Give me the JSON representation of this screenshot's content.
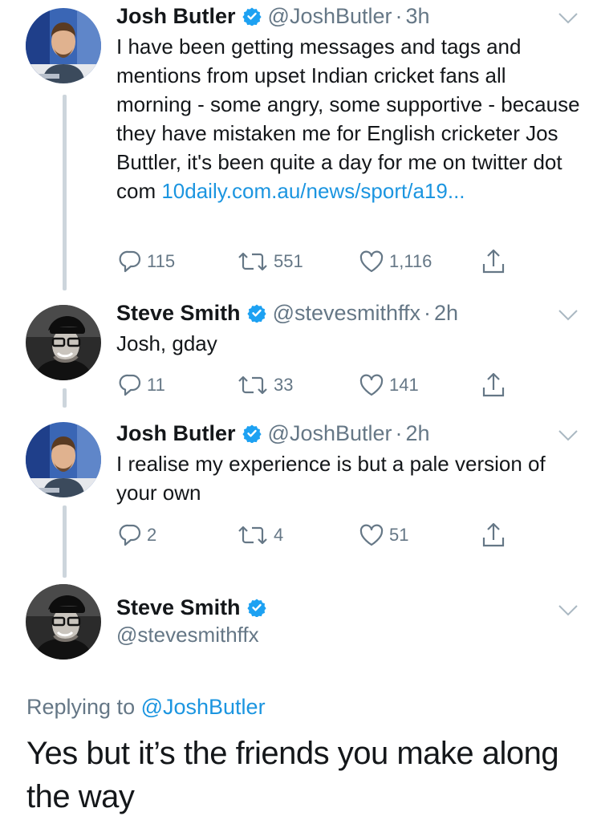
{
  "tweets": [
    {
      "name": "Josh Butler",
      "handle": "@JoshButler",
      "time": "3h",
      "text": "I have been getting messages and tags and mentions from upset Indian cricket fans all morning - some angry, some supportive - because they have mistaken me for English cricketer Jos Buttler, it's been quite a day for me on twitter dot com ",
      "link": "10daily.com.au/news/sport/a19...",
      "replies": "115",
      "retweets": "551",
      "likes": "1,116",
      "avatar": "josh-avatar"
    },
    {
      "name": "Steve Smith",
      "handle": "@stevesmithffx",
      "time": "2h",
      "text": "Josh, gday",
      "replies": "11",
      "retweets": "33",
      "likes": "141",
      "avatar": "steve-avatar"
    },
    {
      "name": "Josh Butler",
      "handle": "@JoshButler",
      "time": "2h",
      "text": "I realise my experience is but a pale version of your own",
      "replies": "2",
      "retweets": "4",
      "likes": "51",
      "avatar": "josh-avatar"
    }
  ],
  "main_tweet": {
    "name": "Steve Smith",
    "handle": "@stevesmithffx",
    "replying_prefix": "Replying to ",
    "replying_to": "@JoshButler",
    "text": "Yes but it’s the friends you make along the way"
  },
  "separator": "·",
  "icons": {
    "reply": "reply-icon",
    "retweet": "retweet-icon",
    "like": "heart-icon",
    "share": "share-icon",
    "verified": "verified-badge-icon",
    "menu": "chevron-down-icon"
  },
  "colors": {
    "link": "#1b95e0",
    "secondary": "#657786",
    "verified": "#1da1f2",
    "thread_line": "#cdd5dc"
  }
}
